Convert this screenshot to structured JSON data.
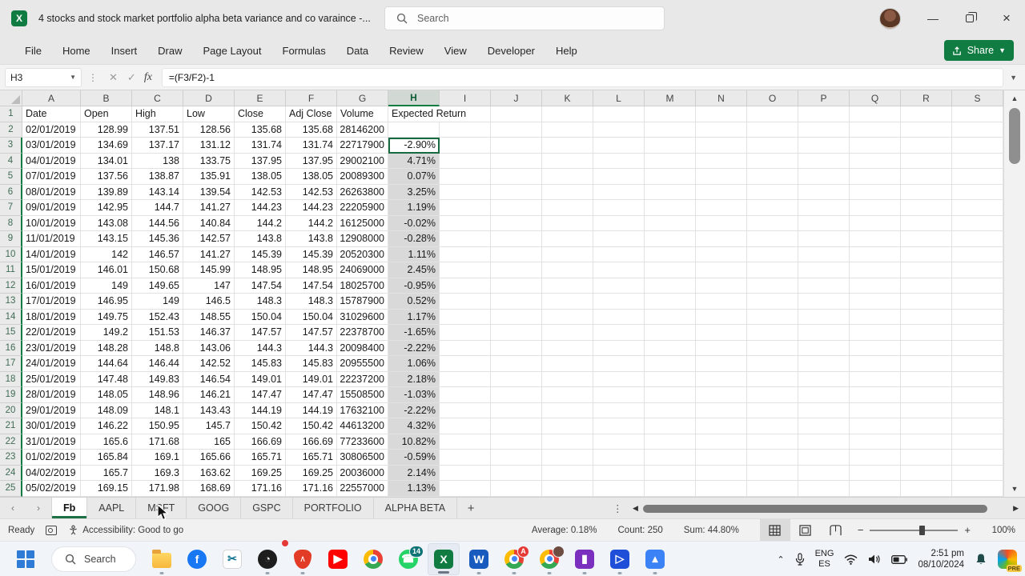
{
  "colors": {
    "accent": "#107C41",
    "selection_fill": "#D9D9D9",
    "share_button": "#107C41"
  },
  "window": {
    "title": "4 stocks and stock market portfolio alpha beta variance and co varaince  -...",
    "search_placeholder": "Search"
  },
  "ribbon": {
    "tabs": [
      "File",
      "Home",
      "Insert",
      "Draw",
      "Page Layout",
      "Formulas",
      "Data",
      "Review",
      "View",
      "Developer",
      "Help"
    ],
    "share_label": "Share"
  },
  "formula_bar": {
    "name_box": "H3",
    "formula": "=(F3/F2)-1"
  },
  "grid": {
    "column_letters": [
      "A",
      "B",
      "C",
      "D",
      "E",
      "F",
      "G",
      "H",
      "I",
      "J",
      "K",
      "L",
      "M",
      "N",
      "O",
      "P",
      "Q",
      "R",
      "S"
    ],
    "selected_column": "H",
    "active_cell": "H3",
    "header_row": [
      "Date",
      "Open",
      "High",
      "Low",
      "Close",
      "Adj Close",
      "Volume",
      "Expected Return"
    ],
    "rows": [
      [
        "02/01/2019",
        "128.99",
        "137.51",
        "128.56",
        "135.68",
        "135.68",
        "28146200",
        ""
      ],
      [
        "03/01/2019",
        "134.69",
        "137.17",
        "131.12",
        "131.74",
        "131.74",
        "22717900",
        "-2.90%"
      ],
      [
        "04/01/2019",
        "134.01",
        "138",
        "133.75",
        "137.95",
        "137.95",
        "29002100",
        "4.71%"
      ],
      [
        "07/01/2019",
        "137.56",
        "138.87",
        "135.91",
        "138.05",
        "138.05",
        "20089300",
        "0.07%"
      ],
      [
        "08/01/2019",
        "139.89",
        "143.14",
        "139.54",
        "142.53",
        "142.53",
        "26263800",
        "3.25%"
      ],
      [
        "09/01/2019",
        "142.95",
        "144.7",
        "141.27",
        "144.23",
        "144.23",
        "22205900",
        "1.19%"
      ],
      [
        "10/01/2019",
        "143.08",
        "144.56",
        "140.84",
        "144.2",
        "144.2",
        "16125000",
        "-0.02%"
      ],
      [
        "11/01/2019",
        "143.15",
        "145.36",
        "142.57",
        "143.8",
        "143.8",
        "12908000",
        "-0.28%"
      ],
      [
        "14/01/2019",
        "142",
        "146.57",
        "141.27",
        "145.39",
        "145.39",
        "20520300",
        "1.11%"
      ],
      [
        "15/01/2019",
        "146.01",
        "150.68",
        "145.99",
        "148.95",
        "148.95",
        "24069000",
        "2.45%"
      ],
      [
        "16/01/2019",
        "149",
        "149.65",
        "147",
        "147.54",
        "147.54",
        "18025700",
        "-0.95%"
      ],
      [
        "17/01/2019",
        "146.95",
        "149",
        "146.5",
        "148.3",
        "148.3",
        "15787900",
        "0.52%"
      ],
      [
        "18/01/2019",
        "149.75",
        "152.43",
        "148.55",
        "150.04",
        "150.04",
        "31029600",
        "1.17%"
      ],
      [
        "22/01/2019",
        "149.2",
        "151.53",
        "146.37",
        "147.57",
        "147.57",
        "22378700",
        "-1.65%"
      ],
      [
        "23/01/2019",
        "148.28",
        "148.8",
        "143.06",
        "144.3",
        "144.3",
        "20098400",
        "-2.22%"
      ],
      [
        "24/01/2019",
        "144.64",
        "146.44",
        "142.52",
        "145.83",
        "145.83",
        "20955500",
        "1.06%"
      ],
      [
        "25/01/2019",
        "147.48",
        "149.83",
        "146.54",
        "149.01",
        "149.01",
        "22237200",
        "2.18%"
      ],
      [
        "28/01/2019",
        "148.05",
        "148.96",
        "146.21",
        "147.47",
        "147.47",
        "15508500",
        "-1.03%"
      ],
      [
        "29/01/2019",
        "148.09",
        "148.1",
        "143.43",
        "144.19",
        "144.19",
        "17632100",
        "-2.22%"
      ],
      [
        "30/01/2019",
        "146.22",
        "150.95",
        "145.7",
        "150.42",
        "150.42",
        "44613200",
        "4.32%"
      ],
      [
        "31/01/2019",
        "165.6",
        "171.68",
        "165",
        "166.69",
        "166.69",
        "77233600",
        "10.82%"
      ],
      [
        "01/02/2019",
        "165.84",
        "169.1",
        "165.66",
        "165.71",
        "165.71",
        "30806500",
        "-0.59%"
      ],
      [
        "04/02/2019",
        "165.7",
        "169.3",
        "163.62",
        "169.25",
        "169.25",
        "20036000",
        "2.14%"
      ],
      [
        "05/02/2019",
        "169.15",
        "171.98",
        "168.69",
        "171.16",
        "171.16",
        "22557000",
        "1.13%"
      ]
    ]
  },
  "sheet_tabs": {
    "tabs": [
      {
        "label": "Fb",
        "active": true
      },
      {
        "label": "AAPL",
        "active": false
      },
      {
        "label": "MSFT",
        "active": false
      },
      {
        "label": "GOOG",
        "active": false
      },
      {
        "label": "GSPC",
        "active": false
      },
      {
        "label": "PORTFOLIO",
        "active": false
      },
      {
        "label": "ALPHA BETA",
        "active": false
      }
    ],
    "add_label": "+"
  },
  "status_bar": {
    "ready": "Ready",
    "accessibility": "Accessibility: Good to go",
    "average": "Average: 0.18%",
    "count": "Count: 250",
    "sum": "Sum: 44.80%",
    "zoom": "100%"
  },
  "taskbar": {
    "search_label": "Search",
    "apps": [
      {
        "name": "start-button",
        "kind": "start"
      },
      {
        "name": "taskbar-search",
        "kind": "search"
      },
      {
        "name": "file-explorer-icon",
        "kind": "explorer",
        "running": true
      },
      {
        "name": "facebook-icon",
        "kind": "glyph",
        "glyph": "f",
        "bg": "#1877F2",
        "fg": "#ffffff",
        "round": true
      },
      {
        "name": "snipping-tool-icon",
        "kind": "glyph",
        "glyph": "✂",
        "bg": "#ffffff",
        "fg": "#0E7490",
        "border": true
      },
      {
        "name": "obs-studio-icon",
        "kind": "obs",
        "glyph": "◔",
        "badge_dot": "#E53935",
        "running": true
      },
      {
        "name": "brave-icon",
        "kind": "brave",
        "glyph": "∧",
        "running": true
      },
      {
        "name": "youtube-icon",
        "kind": "glyph",
        "glyph": "▶",
        "bg": "#FF0000",
        "fg": "#ffffff"
      },
      {
        "name": "chrome-icon",
        "kind": "chrome"
      },
      {
        "name": "whatsapp-icon",
        "kind": "glyph",
        "glyph": "☎",
        "bg": "#25D366",
        "fg": "#ffffff",
        "round": true,
        "badge": "14",
        "badge_bg": "#0D7377"
      },
      {
        "name": "excel-icon",
        "kind": "glyph",
        "glyph": "X",
        "bg": "#107C41",
        "fg": "#ffffff",
        "active": true
      },
      {
        "name": "word-icon",
        "kind": "glyph",
        "glyph": "W",
        "bg": "#185ABD",
        "fg": "#ffffff",
        "running": true
      },
      {
        "name": "chrome-profile-a-icon",
        "kind": "chrome",
        "badge": "A",
        "badge_bg": "#E53935",
        "running": true
      },
      {
        "name": "chrome-profile-b-icon",
        "kind": "chrome",
        "badge": "",
        "badge_bg": "#6D4C41",
        "running": true
      },
      {
        "name": "clipchamp-icon",
        "kind": "glyph",
        "glyph": "▮",
        "bg": "#7B2FBE",
        "fg": "#ffffff",
        "running": true
      },
      {
        "name": "movies-tv-icon",
        "kind": "glyph",
        "glyph": "▷",
        "bg": "#1F4FD8",
        "fg": "#ffffff",
        "running": true
      },
      {
        "name": "photos-icon",
        "kind": "glyph",
        "glyph": "▴",
        "bg": "#3B82F6",
        "fg": "#ffffff",
        "running": true
      }
    ],
    "tray": {
      "language": "ENG",
      "language_region": "ES",
      "time": "2:51 pm",
      "date": "08/10/2024"
    }
  }
}
